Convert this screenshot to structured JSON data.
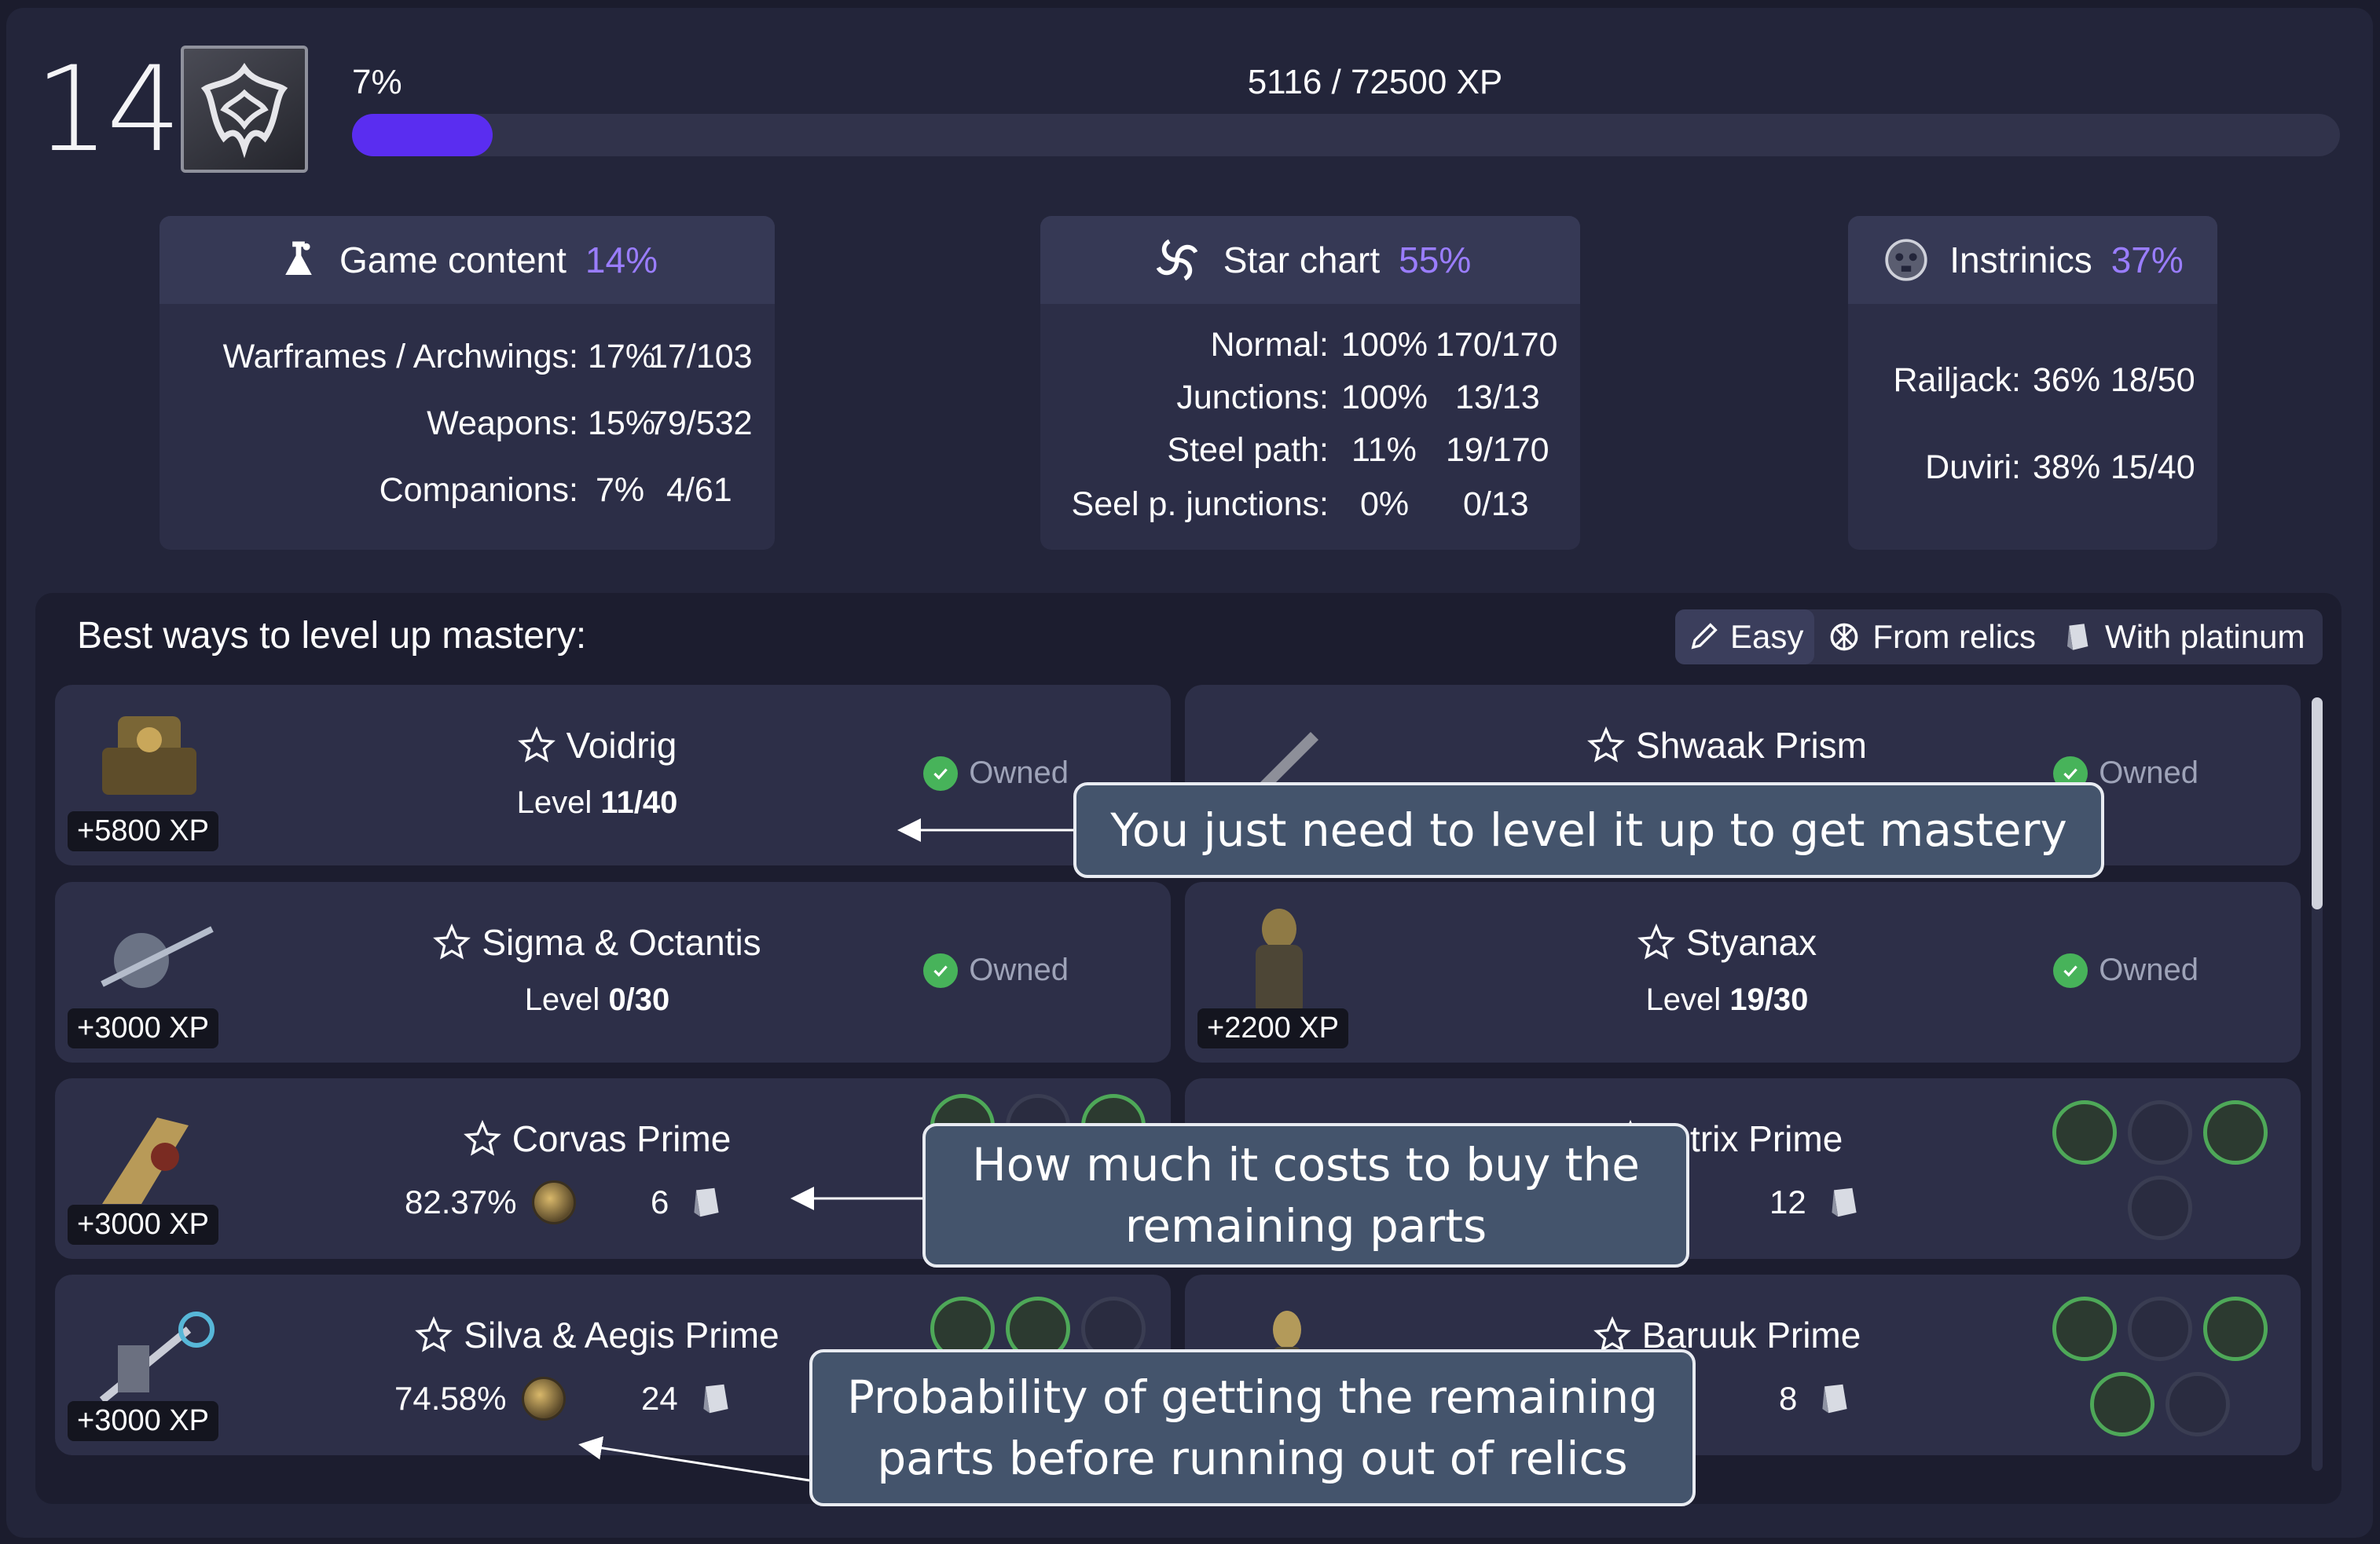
{
  "header": {
    "mastery_rank": "14",
    "progress_label": "7%",
    "progress_value": 0.0706,
    "xp_text": "5116 / 72500 XP"
  },
  "cards": {
    "game_content": {
      "title": "Game content",
      "pct": "14%",
      "icon": "lab-flask-icon",
      "rows": [
        {
          "label": "Warframes / Archwings:",
          "pct": "17%",
          "count": "17/103"
        },
        {
          "label": "Weapons:",
          "pct": "15%",
          "count": "79/532"
        },
        {
          "label": "Companions:",
          "pct": "7%",
          "count": "4/61"
        }
      ]
    },
    "star_chart": {
      "title": "Star chart",
      "pct": "55%",
      "icon": "spiral-galaxy-icon",
      "rows": [
        {
          "label": "Normal:",
          "pct": "100%",
          "count": "170/170"
        },
        {
          "label": "Junctions:",
          "pct": "100%",
          "count": "13/13"
        },
        {
          "label": "Steel path:",
          "pct": "11%",
          "count": "19/170"
        },
        {
          "label": "Seel p. junctions:",
          "pct": "0%",
          "count": "0/13"
        }
      ]
    },
    "intrinsics": {
      "title": "Instrinics",
      "pct": "37%",
      "icon": "intrinsics-skull-icon",
      "rows": [
        {
          "label": "Railjack:",
          "pct": "36%",
          "count": "18/50"
        },
        {
          "label": "Duviri:",
          "pct": "38%",
          "count": "15/40"
        }
      ]
    }
  },
  "best_ways": {
    "title": "Best ways to level up mastery:",
    "filters": [
      {
        "label": "Easy",
        "icon": "pencil-icon",
        "active": true
      },
      {
        "label": "From relics",
        "icon": "relic-icon",
        "active": false
      },
      {
        "label": "With platinum",
        "icon": "platinum-icon",
        "active": false
      }
    ],
    "items": [
      {
        "name": "Voidrig",
        "xp": "+5800 XP",
        "sub_prefix": "Level ",
        "sub_value": "11/40",
        "owned": "Owned"
      },
      {
        "name": "Shwaak Prism",
        "xp": "",
        "owned": "Owned"
      },
      {
        "name": "Sigma & Octantis",
        "xp": "+3000 XP",
        "sub_prefix": "Level ",
        "sub_value": "0/30",
        "owned": "Owned"
      },
      {
        "name": "Styanax",
        "xp": "+2200 XP",
        "sub_prefix": "Level ",
        "sub_value": "19/30",
        "owned": "Owned"
      },
      {
        "name": "Corvas Prime",
        "xp": "+3000 XP",
        "relic_chance": "82.37%",
        "plat": "6"
      },
      {
        "name": "...trix Prime",
        "xp": "",
        "plat": "12"
      },
      {
        "name": "Silva & Aegis Prime",
        "xp": "+3000 XP",
        "relic_chance": "74.58%",
        "plat": "24"
      },
      {
        "name": "Baruuk Prime",
        "xp": "",
        "plat": "8"
      }
    ]
  },
  "callouts": {
    "level_up": "You just need to level it up to get mastery",
    "cost": "How much it costs to buy the remaining parts",
    "probability": "Probability of getting the remaining parts before running out of relics"
  },
  "colors": {
    "accent_purple": "#9a7dff",
    "progress_fill": "#5a2df0",
    "owned_green": "#47b35a",
    "callout_bg": "#44546c"
  }
}
